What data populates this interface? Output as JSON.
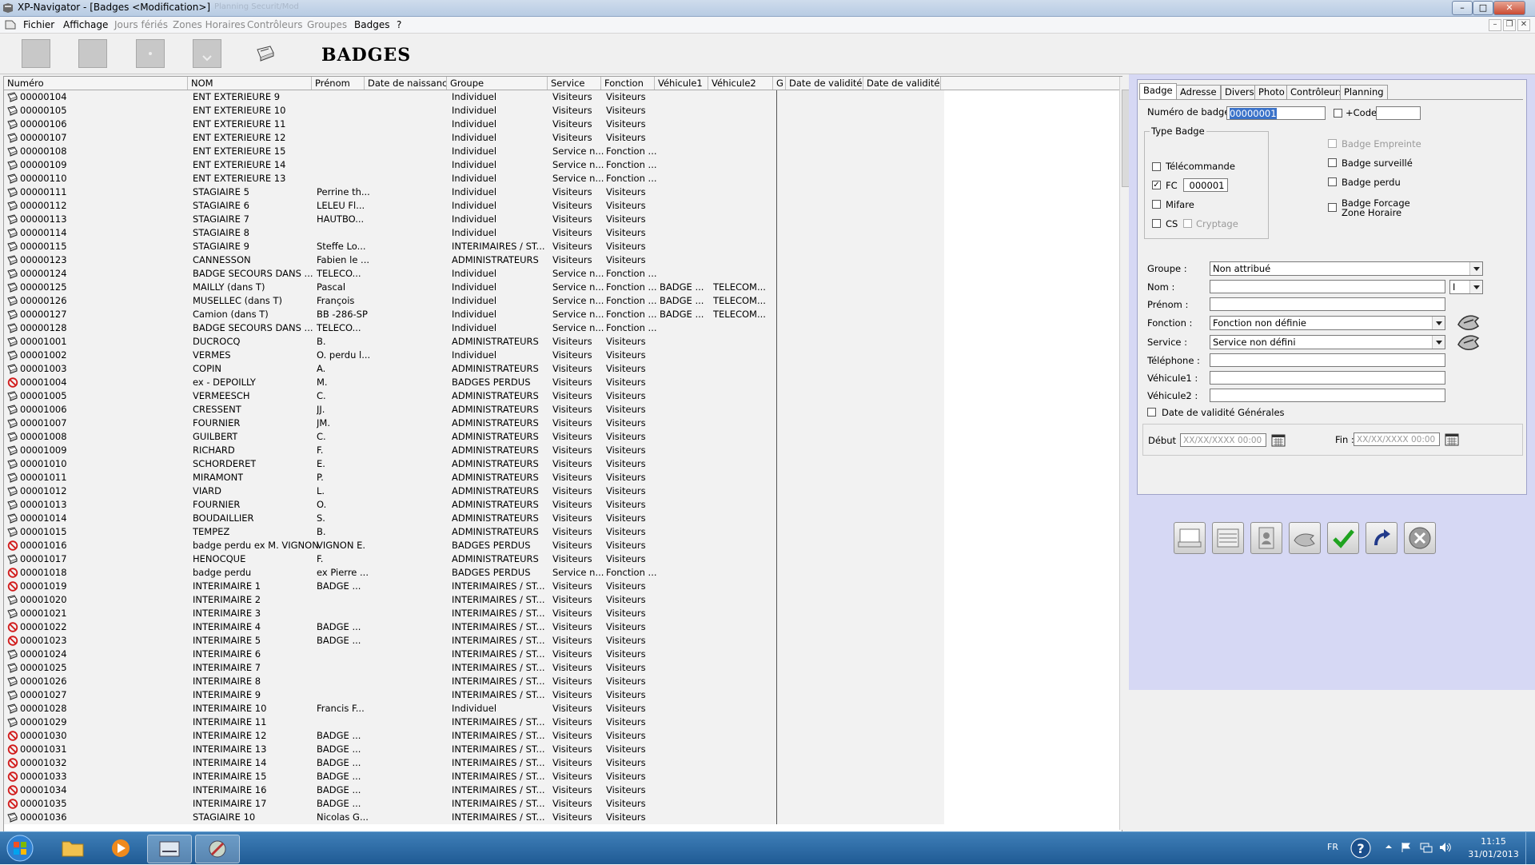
{
  "window": {
    "title": "XP-Navigator - [Badges <Modification>]",
    "ghost_title": "Planning  Securit/Mod"
  },
  "menu": {
    "items": [
      {
        "label": "Fichier",
        "enabled": true
      },
      {
        "label": "Affichage",
        "enabled": true
      },
      {
        "label": "Jours fériés",
        "enabled": false
      },
      {
        "label": "Zones Horaires",
        "enabled": false
      },
      {
        "label": "Contrôleurs",
        "enabled": false
      },
      {
        "label": "Groupes",
        "enabled": false
      },
      {
        "label": "Badges",
        "enabled": true
      },
      {
        "label": "?",
        "enabled": true
      }
    ]
  },
  "toolbar": {
    "page_title": "BADGES",
    "buttons": [
      "new-icon",
      "save-icon",
      "search-icon",
      "download-icon",
      "print-icon"
    ]
  },
  "table": {
    "columns": [
      "Numéro",
      "NOM",
      "Prénom",
      "Date de naissance",
      "Groupe",
      "Service",
      "Fonction",
      "Véhicule1",
      "Véhicule2",
      "G",
      "Date de validité...",
      "Date de validité..."
    ],
    "rows": [
      [
        "00000104",
        "ENT EXTERIEURE 9",
        "",
        "Individuel",
        "Visiteurs",
        "Visiteurs",
        "",
        "",
        "normal"
      ],
      [
        "00000105",
        "ENT EXTERIEURE 10",
        "",
        "Individuel",
        "Visiteurs",
        "Visiteurs",
        "",
        "",
        "normal"
      ],
      [
        "00000106",
        "ENT EXTERIEURE 11",
        "",
        "Individuel",
        "Visiteurs",
        "Visiteurs",
        "",
        "",
        "normal"
      ],
      [
        "00000107",
        "ENT EXTERIEURE 12",
        "",
        "Individuel",
        "Visiteurs",
        "Visiteurs",
        "",
        "",
        "normal"
      ],
      [
        "00000108",
        "ENT EXTERIEURE 15",
        "",
        "Individuel",
        "Service n...",
        "Fonction ...",
        "",
        "",
        "normal"
      ],
      [
        "00000109",
        "ENT EXTERIEURE 14",
        "",
        "Individuel",
        "Service n...",
        "Fonction ...",
        "",
        "",
        "normal"
      ],
      [
        "00000110",
        "ENT EXTERIEURE 13",
        "",
        "Individuel",
        "Service n...",
        "Fonction ...",
        "",
        "",
        "normal"
      ],
      [
        "00000111",
        "STAGIAIRE 5",
        "Perrine th...",
        "Individuel",
        "Visiteurs",
        "Visiteurs",
        "",
        "",
        "normal"
      ],
      [
        "00000112",
        "STAGIAIRE 6",
        "LELEU Fl...",
        "Individuel",
        "Visiteurs",
        "Visiteurs",
        "",
        "",
        "normal"
      ],
      [
        "00000113",
        "STAGIAIRE 7",
        "HAUTBO...",
        "Individuel",
        "Visiteurs",
        "Visiteurs",
        "",
        "",
        "normal"
      ],
      [
        "00000114",
        "STAGIAIRE 8",
        "",
        "Individuel",
        "Visiteurs",
        "Visiteurs",
        "",
        "",
        "normal"
      ],
      [
        "00000115",
        "STAGIAIRE 9",
        "Steffe Lo...",
        "INTERIMAIRES / ST...",
        "Visiteurs",
        "Visiteurs",
        "",
        "",
        "normal"
      ],
      [
        "00000123",
        "CANNESSON",
        "Fabien le ...",
        "ADMINISTRATEURS",
        "Visiteurs",
        "Visiteurs",
        "",
        "",
        "normal"
      ],
      [
        "00000124",
        "BADGE SECOURS DANS ...",
        "TELECO...",
        "Individuel",
        "Service n...",
        "Fonction ...",
        "",
        "",
        "normal"
      ],
      [
        "00000125",
        "MAILLY (dans T)",
        "Pascal",
        "Individuel",
        "Service n...",
        "Fonction ...",
        "BADGE ...",
        "TELECOM...",
        "normal"
      ],
      [
        "00000126",
        "MUSELLEC (dans T)",
        "François",
        "Individuel",
        "Service n...",
        "Fonction ...",
        "BADGE ...",
        "TELECOM...",
        "normal"
      ],
      [
        "00000127",
        "Camion (dans T)",
        "BB -286-SP",
        "Individuel",
        "Service n...",
        "Fonction ...",
        "BADGE ...",
        "TELECOM...",
        "normal"
      ],
      [
        "00000128",
        "BADGE SECOURS DANS ...",
        "TELECO...",
        "Individuel",
        "Service n...",
        "Fonction ...",
        "",
        "",
        "normal"
      ],
      [
        "00001001",
        "DUCROCQ",
        "B.",
        "ADMINISTRATEURS",
        "Visiteurs",
        "Visiteurs",
        "",
        "",
        "normal"
      ],
      [
        "00001002",
        "VERMES",
        "O. perdu l...",
        "Individuel",
        "Visiteurs",
        "Visiteurs",
        "",
        "",
        "normal"
      ],
      [
        "00001003",
        "COPIN",
        "A.",
        "ADMINISTRATEURS",
        "Visiteurs",
        "Visiteurs",
        "",
        "",
        "normal"
      ],
      [
        "00001004",
        "ex - DEPOILLY",
        "M.",
        "BADGES PERDUS",
        "Visiteurs",
        "Visiteurs",
        "",
        "",
        "lost"
      ],
      [
        "00001005",
        "VERMEESCH",
        "C.",
        "ADMINISTRATEURS",
        "Visiteurs",
        "Visiteurs",
        "",
        "",
        "normal"
      ],
      [
        "00001006",
        "CRESSENT",
        "JJ.",
        "ADMINISTRATEURS",
        "Visiteurs",
        "Visiteurs",
        "",
        "",
        "normal"
      ],
      [
        "00001007",
        "FOURNIER",
        "JM.",
        "ADMINISTRATEURS",
        "Visiteurs",
        "Visiteurs",
        "",
        "",
        "normal"
      ],
      [
        "00001008",
        "GUILBERT",
        "C.",
        "ADMINISTRATEURS",
        "Visiteurs",
        "Visiteurs",
        "",
        "",
        "normal"
      ],
      [
        "00001009",
        "RICHARD",
        "F.",
        "ADMINISTRATEURS",
        "Visiteurs",
        "Visiteurs",
        "",
        "",
        "normal"
      ],
      [
        "00001010",
        "SCHORDERET",
        "E.",
        "ADMINISTRATEURS",
        "Visiteurs",
        "Visiteurs",
        "",
        "",
        "normal"
      ],
      [
        "00001011",
        "MIRAMONT",
        "P.",
        "ADMINISTRATEURS",
        "Visiteurs",
        "Visiteurs",
        "",
        "",
        "normal"
      ],
      [
        "00001012",
        "VIARD",
        "L.",
        "ADMINISTRATEURS",
        "Visiteurs",
        "Visiteurs",
        "",
        "",
        "normal"
      ],
      [
        "00001013",
        "FOURNIER",
        "O.",
        "ADMINISTRATEURS",
        "Visiteurs",
        "Visiteurs",
        "",
        "",
        "normal"
      ],
      [
        "00001014",
        "BOUDAILLIER",
        "S.",
        "ADMINISTRATEURS",
        "Visiteurs",
        "Visiteurs",
        "",
        "",
        "normal"
      ],
      [
        "00001015",
        "TEMPEZ",
        "B.",
        "ADMINISTRATEURS",
        "Visiteurs",
        "Visiteurs",
        "",
        "",
        "normal"
      ],
      [
        "00001016",
        "badge perdu ex M. VIGNON",
        "VIGNON E.",
        "BADGES PERDUS",
        "Visiteurs",
        "Visiteurs",
        "",
        "",
        "lost"
      ],
      [
        "00001017",
        "HENOCQUE",
        "F.",
        "ADMINISTRATEURS",
        "Visiteurs",
        "Visiteurs",
        "",
        "",
        "normal"
      ],
      [
        "00001018",
        "badge perdu",
        "ex Pierre ...",
        "BADGES PERDUS",
        "Service n...",
        "Fonction ...",
        "",
        "",
        "lost"
      ],
      [
        "00001019",
        "INTERIMAIRE 1",
        "BADGE ...",
        "INTERIMAIRES / ST...",
        "Visiteurs",
        "Visiteurs",
        "",
        "",
        "lost"
      ],
      [
        "00001020",
        "INTERIMAIRE 2",
        "",
        "INTERIMAIRES / ST...",
        "Visiteurs",
        "Visiteurs",
        "",
        "",
        "normal"
      ],
      [
        "00001021",
        "INTERIMAIRE 3",
        "",
        "INTERIMAIRES / ST...",
        "Visiteurs",
        "Visiteurs",
        "",
        "",
        "normal"
      ],
      [
        "00001022",
        "INTERIMAIRE 4",
        "BADGE ...",
        "INTERIMAIRES / ST...",
        "Visiteurs",
        "Visiteurs",
        "",
        "",
        "lost"
      ],
      [
        "00001023",
        "INTERIMAIRE 5",
        "BADGE ...",
        "INTERIMAIRES / ST...",
        "Visiteurs",
        "Visiteurs",
        "",
        "",
        "lost"
      ],
      [
        "00001024",
        "INTERIMAIRE 6",
        "",
        "INTERIMAIRES / ST...",
        "Visiteurs",
        "Visiteurs",
        "",
        "",
        "normal"
      ],
      [
        "00001025",
        "INTERIMAIRE 7",
        "",
        "INTERIMAIRES / ST...",
        "Visiteurs",
        "Visiteurs",
        "",
        "",
        "normal"
      ],
      [
        "00001026",
        "INTERIMAIRE 8",
        "",
        "INTERIMAIRES / ST...",
        "Visiteurs",
        "Visiteurs",
        "",
        "",
        "normal"
      ],
      [
        "00001027",
        "INTERIMAIRE 9",
        "",
        "INTERIMAIRES / ST...",
        "Visiteurs",
        "Visiteurs",
        "",
        "",
        "normal"
      ],
      [
        "00001028",
        "INTERIMAIRE 10",
        "Francis F...",
        "Individuel",
        "Visiteurs",
        "Visiteurs",
        "",
        "",
        "normal"
      ],
      [
        "00001029",
        "INTERIMAIRE 11",
        "",
        "INTERIMAIRES / ST...",
        "Visiteurs",
        "Visiteurs",
        "",
        "",
        "normal"
      ],
      [
        "00001030",
        "INTERIMAIRE 12",
        "BADGE ...",
        "INTERIMAIRES / ST...",
        "Visiteurs",
        "Visiteurs",
        "",
        "",
        "lost"
      ],
      [
        "00001031",
        "INTERIMAIRE 13",
        "BADGE ...",
        "INTERIMAIRES / ST...",
        "Visiteurs",
        "Visiteurs",
        "",
        "",
        "lost"
      ],
      [
        "00001032",
        "INTERIMAIRE 14",
        "BADGE ...",
        "INTERIMAIRES / ST...",
        "Visiteurs",
        "Visiteurs",
        "",
        "",
        "lost"
      ],
      [
        "00001033",
        "INTERIMAIRE 15",
        "BADGE ...",
        "INTERIMAIRES / ST...",
        "Visiteurs",
        "Visiteurs",
        "",
        "",
        "lost"
      ],
      [
        "00001034",
        "INTERIMAIRE 16",
        "BADGE ...",
        "INTERIMAIRES / ST...",
        "Visiteurs",
        "Visiteurs",
        "",
        "",
        "lost"
      ],
      [
        "00001035",
        "INTERIMAIRE 17",
        "BADGE ...",
        "INTERIMAIRES / ST...",
        "Visiteurs",
        "Visiteurs",
        "",
        "",
        "lost"
      ],
      [
        "00001036",
        "STAGIAIRE 10",
        "Nicolas G...",
        "INTERIMAIRES / ST...",
        "Visiteurs",
        "Visiteurs",
        "",
        "",
        "normal"
      ]
    ]
  },
  "form": {
    "tabs": [
      "Badge",
      "Adresse",
      "Divers",
      "Photo",
      "Contrôleurs",
      "Planning"
    ],
    "active_tab": "Badge",
    "badge_number_label": "Numéro de badge :",
    "badge_number_value": "00000001",
    "plus_code_label": "+Code",
    "plus_code_value": "",
    "type_badge_legend": "Type Badge",
    "telecommande_label": "Télécommande",
    "fc_label": "FC",
    "fc_value": "000001",
    "mifare_label": "Mifare",
    "cs_label": "CS",
    "cryptage_label": "Cryptage",
    "badge_empreinte_label": "Badge Empreinte",
    "badge_surveille_label": "Badge surveillé",
    "badge_perdu_label": "Badge perdu",
    "badge_forcage_label_1": "Badge Forcage",
    "badge_forcage_label_2": "Zone Horaire",
    "groupe_label": "Groupe :",
    "groupe_value": "Non attribué",
    "nom_label": "Nom :",
    "nom_value": "",
    "nom_suffix_value": "I",
    "prenom_label": "Prénom :",
    "prenom_value": "",
    "fonction_label": "Fonction :",
    "fonction_value": "Fonction non définie",
    "service_label": "Service :",
    "service_value": "Service non défini",
    "telephone_label": "Téléphone :",
    "telephone_value": "",
    "vehicule1_label": "Véhicule1 :",
    "vehicule1_value": "",
    "vehicule2_label": "Véhicule2 :",
    "vehicule2_value": "",
    "date_validite_label": "Date de validité Générales",
    "debut_label": "Début :",
    "debut_placeholder": "XX/XX/XXXX 00:00",
    "fin_label": "Fin :",
    "fin_placeholder": "XX/XX/XXXX 00:00"
  },
  "actions": [
    "new-badge-icon",
    "list-icon",
    "badge-card-icon",
    "hand-icon",
    "check-icon",
    "undo-icon",
    "cancel-icon"
  ],
  "taskbar": {
    "lang": "FR",
    "time": "11:15",
    "date": "31/01/2013"
  },
  "colors": {
    "side_panel_bg": "#d6d8f4",
    "lost_icon": "#d11a1a",
    "taskbar": "#2a6aa6"
  }
}
